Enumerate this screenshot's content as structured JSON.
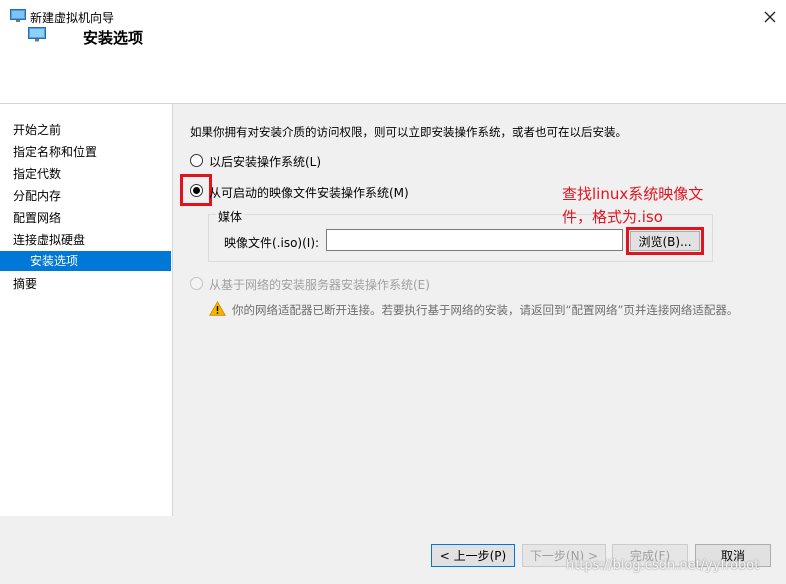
{
  "window": {
    "title": "新建虚拟机向导",
    "icon": "monitor-icon",
    "close_icon": "close-icon",
    "close_label": "✕"
  },
  "header": {
    "title": "安装选项",
    "icon": "monitor-icon"
  },
  "sidebar": {
    "items": [
      {
        "label": "开始之前",
        "active": false
      },
      {
        "label": "指定名称和位置",
        "active": false
      },
      {
        "label": "指定代数",
        "active": false
      },
      {
        "label": "分配内存",
        "active": false
      },
      {
        "label": "配置网络",
        "active": false
      },
      {
        "label": "连接虚拟硬盘",
        "active": false
      },
      {
        "label": "安装选项",
        "active": true
      },
      {
        "label": "摘要",
        "active": false
      }
    ]
  },
  "main": {
    "intro": "如果你拥有对安装介质的访问权限，则可以立即安装操作系统，或者也可在以后安装。",
    "options": [
      {
        "label": "以后安装操作系统(L)",
        "checked": false,
        "disabled": false
      },
      {
        "label": "从可启动的映像文件安装操作系统(M)",
        "checked": true,
        "disabled": false
      },
      {
        "label": "从基于网络的安装服务器安装操作系统(E)",
        "checked": false,
        "disabled": true
      }
    ],
    "media": {
      "legend": "媒体",
      "iso_label": "映像文件(.iso)(I):",
      "iso_value": "",
      "browse_label": "浏览(B)..."
    },
    "warning": {
      "icon": "warning-icon",
      "text": "你的网络适配器已断开连接。若要执行基于网络的安装，请返回到“配置网络”页并连接网络适配器。"
    },
    "annotation": "查找linux系统映像文件，格式为.iso"
  },
  "footer": {
    "back": "< 上一步(P)",
    "next": "下一步(N) >",
    "finish": "完成(F)",
    "cancel": "取消"
  },
  "watermark": "https://blog.csdn.net/yyfrobot",
  "colors": {
    "accent": "#0078d7",
    "annotation": "#e0141e",
    "warning": "#f5b400"
  }
}
